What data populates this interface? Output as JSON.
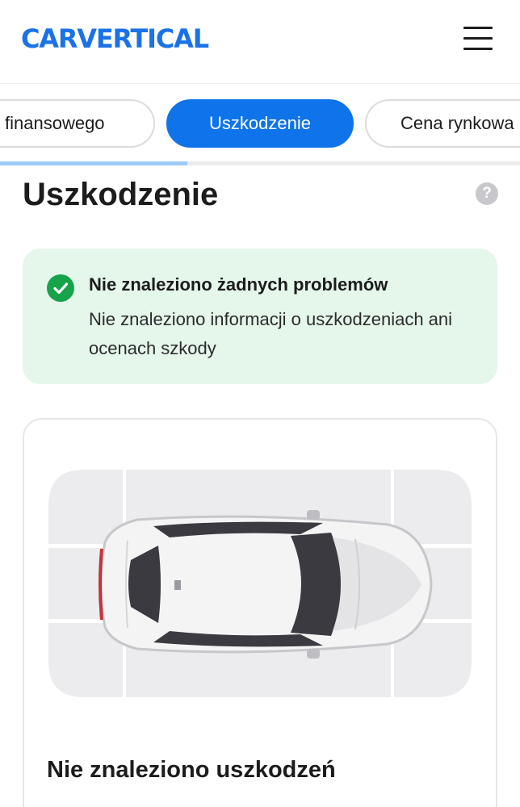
{
  "header": {
    "logo": "CARVERTICAL",
    "menu_icon": "hamburger-menu-icon"
  },
  "tabs": [
    {
      "label": "finansowego",
      "active": false
    },
    {
      "label": "Uszkodzenie",
      "active": true
    },
    {
      "label": "Cena rynkowa",
      "active": false
    }
  ],
  "tab_progress": 0.36,
  "section": {
    "title": "Uszkodzenie",
    "help_label": "?"
  },
  "alert": {
    "title": "Nie znaleziono żadnych problemów",
    "text": "Nie znaleziono informacji o uszkodzeniach ani ocenach szkody",
    "icon": "check-circle-icon"
  },
  "damage_card": {
    "title": "Nie znaleziono uszkodzeń",
    "diagram": "car-top-view"
  },
  "colors": {
    "brand": "#1b72e8",
    "tab_active": "#0f73ea",
    "success": "#16a34a",
    "success_bg": "#e5f6ea",
    "zone_fill": "#ececee"
  }
}
